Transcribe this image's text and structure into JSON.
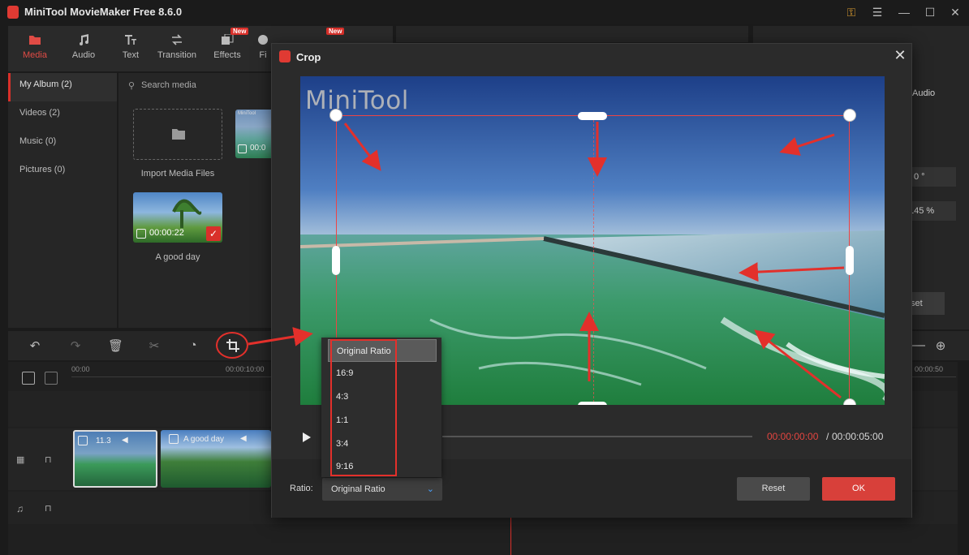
{
  "app": {
    "title": "MiniTool MovieMaker Free 8.6.0"
  },
  "toolbar": {
    "items": [
      {
        "label": "Media",
        "icon": "media-folder-icon"
      },
      {
        "label": "Audio",
        "icon": "music-note-icon"
      },
      {
        "label": "Text",
        "icon": "text-icon"
      },
      {
        "label": "Transition",
        "icon": "transition-icon"
      },
      {
        "label": "Effects",
        "icon": "effects-icon",
        "badge": "New"
      },
      {
        "label": "Fi",
        "icon": "filters-icon"
      }
    ],
    "extra_badge": "New"
  },
  "sidebar": {
    "items": [
      {
        "label": "My Album (2)"
      },
      {
        "label": "Videos (2)"
      },
      {
        "label": "Music (0)"
      },
      {
        "label": "Pictures (0)"
      }
    ]
  },
  "media": {
    "search_placeholder": "Search media",
    "import_label": "Import Media Files",
    "clip1_duration": "00:0",
    "clip2_duration": "00:00:22",
    "clip2_name": "A good day",
    "clip_thumb_label": "MiniTool"
  },
  "properties": {
    "tab_audio": "Audio",
    "rotation_value": "0 °",
    "scale_value": "145 %",
    "reset_label": "set"
  },
  "timeline": {
    "ruler": [
      "00:00",
      "00:00:10:00",
      "00:00:50"
    ],
    "clip1_label": "11.3",
    "clip2_label": "A good day"
  },
  "crop_dialog": {
    "title": "Crop",
    "watermark": "MiniTool",
    "time_current": "00:00:00:00",
    "time_separator": "/",
    "time_total": "00:00:05:00",
    "ratio_label": "Ratio:",
    "ratio_selected": "Original Ratio",
    "ratio_options": [
      "Original Ratio",
      "16:9",
      "4:3",
      "1:1",
      "3:4",
      "9:16"
    ],
    "reset_label": "Reset",
    "ok_label": "OK"
  },
  "colors": {
    "accent": "#d9302a",
    "ok_button": "#d8403a",
    "time_current": "#e34540",
    "chevron": "#4aa2ff"
  }
}
